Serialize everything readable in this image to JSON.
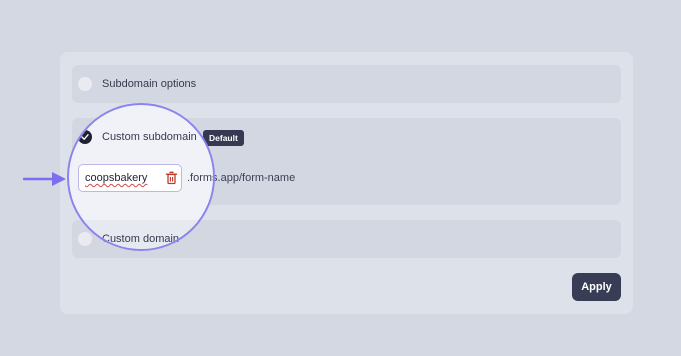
{
  "options": [
    {
      "label": "Subdomain options",
      "checked": false
    },
    {
      "label": "Custom subdomain",
      "checked": true,
      "badge": "Default"
    },
    {
      "label": "Custom domain",
      "checked": false
    }
  ],
  "subdomain": {
    "value": "coopsbakery",
    "suffix": ".forms.app/form-name"
  },
  "apply_label": "Apply",
  "colors": {
    "accent": "#8b84ee",
    "button": "#383c55",
    "delete_icon": "#c0392b"
  },
  "icons": {
    "delete": "trash-icon",
    "pointer": "arrow-right-icon",
    "check": "check-icon"
  }
}
